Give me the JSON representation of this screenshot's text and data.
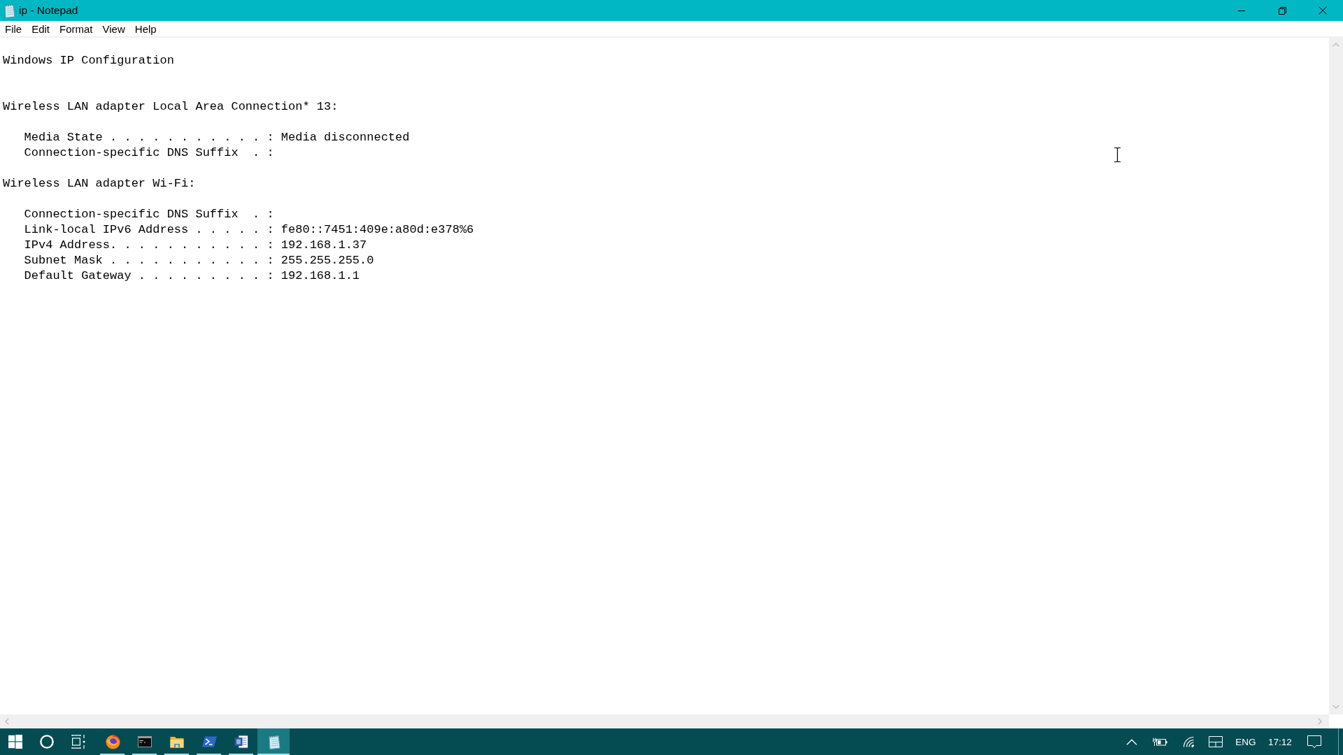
{
  "window": {
    "title": "ip - Notepad"
  },
  "menu": [
    "File",
    "Edit",
    "Format",
    "View",
    "Help"
  ],
  "document": {
    "heading": "Windows IP Configuration",
    "adapters": [
      {
        "title": "Wireless LAN adapter Local Area Connection* 13:",
        "entries": [
          {
            "label": "Media State . . . . . . . . . . . :",
            "value": "Media disconnected"
          },
          {
            "label": "Connection-specific DNS Suffix  . :"
          }
        ]
      },
      {
        "title": "Wireless LAN adapter Wi-Fi:",
        "entries": [
          {
            "label": "Connection-specific DNS Suffix  . :"
          },
          {
            "label": "Link-local IPv6 Address . . . . . :",
            "value": "fe80::7451:409e:a80d:e378%6"
          },
          {
            "label": "IPv4 Address. . . . . . . . . . . :",
            "value": "192.168.1.37"
          },
          {
            "label": "Subnet Mask . . . . . . . . . . . :",
            "value": "255.255.255.0"
          },
          {
            "label": "Default Gateway . . . . . . . . . :",
            "value": "192.168.1.1"
          }
        ]
      }
    ]
  },
  "taskbar": {
    "apps": [
      {
        "kind": "browser",
        "running": true,
        "selected": false
      },
      {
        "kind": "console",
        "running": true,
        "selected": false
      },
      {
        "kind": "folder",
        "running": true,
        "selected": false
      },
      {
        "kind": "shell",
        "running": true,
        "selected": false
      },
      {
        "kind": "document",
        "running": true,
        "selected": false
      },
      {
        "kind": "notepad",
        "running": true,
        "selected": true
      }
    ],
    "tray": {
      "language": "ENG",
      "time": "17:12"
    }
  }
}
